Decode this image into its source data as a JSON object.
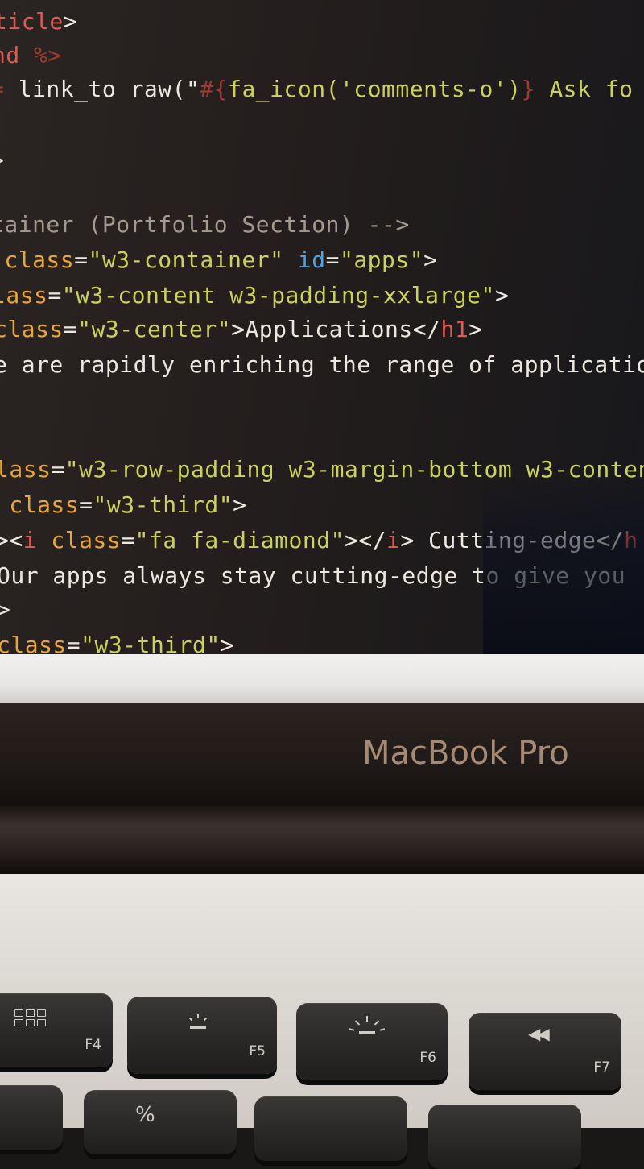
{
  "editor": {
    "lines": [
      [
        {
          "t": "ticle",
          "c": "tag"
        },
        {
          "t": ">",
          "c": "punc"
        }
      ],
      [
        {
          "t": "nd ",
          "c": "tag"
        },
        {
          "t": "%>",
          "c": "erb"
        }
      ],
      [
        {
          "t": "= ",
          "c": "erb"
        },
        {
          "t": "link_to raw(\"",
          "c": "plain"
        },
        {
          "t": "#{",
          "c": "erb"
        },
        {
          "t": "fa_icon('comments-o')",
          "c": "str"
        },
        {
          "t": "}",
          "c": "erb"
        },
        {
          "t": " Ask fo",
          "c": "str"
        }
      ],
      [],
      [
        {
          "t": ">",
          "c": "punc"
        }
      ],
      [],
      [
        {
          "t": "tainer (Portfolio Section) -->",
          "c": "comm"
        }
      ],
      [
        {
          "t": " class",
          "c": "attr"
        },
        {
          "t": "=",
          "c": "punc"
        },
        {
          "t": "\"w3-container\"",
          "c": "str"
        },
        {
          "t": " id",
          "c": "id"
        },
        {
          "t": "=",
          "c": "punc"
        },
        {
          "t": "\"apps\"",
          "c": "str"
        },
        {
          "t": ">",
          "c": "punc"
        }
      ],
      [
        {
          "t": "lass",
          "c": "attr"
        },
        {
          "t": "=",
          "c": "punc"
        },
        {
          "t": "\"w3-content w3-padding-xxlarge\"",
          "c": "str"
        },
        {
          "t": ">",
          "c": "punc"
        }
      ],
      [
        {
          "t": "class",
          "c": "attr"
        },
        {
          "t": "=",
          "c": "punc"
        },
        {
          "t": "\"w3-center\"",
          "c": "str"
        },
        {
          "t": ">Applications</",
          "c": "plain"
        },
        {
          "t": "h1",
          "c": "tag"
        },
        {
          "t": ">",
          "c": "punc"
        }
      ],
      [
        {
          "t": "e are rapidly enriching the range of applicatio",
          "c": "plain"
        }
      ],
      [],
      [],
      [
        {
          "t": "lass",
          "c": "attr"
        },
        {
          "t": "=",
          "c": "punc"
        },
        {
          "t": "\"w3-row-padding w3-margin-bottom w3-conten",
          "c": "str"
        }
      ],
      [
        {
          "t": " class",
          "c": "attr"
        },
        {
          "t": "=",
          "c": "punc"
        },
        {
          "t": "\"w3-third\"",
          "c": "str"
        },
        {
          "t": ">",
          "c": "punc"
        }
      ],
      [
        {
          "t": "><",
          "c": "punc"
        },
        {
          "t": "i",
          "c": "tag"
        },
        {
          "t": " class",
          "c": "attr"
        },
        {
          "t": "=",
          "c": "punc"
        },
        {
          "t": "\"fa fa-diamond\"",
          "c": "str"
        },
        {
          "t": "></",
          "c": "punc"
        },
        {
          "t": "i",
          "c": "tag"
        },
        {
          "t": "> Cutting-edge</",
          "c": "plain"
        },
        {
          "t": "h",
          "c": "tag"
        }
      ],
      [
        {
          "t": "Our apps always stay cutting-edge to give you",
          "c": "plain"
        }
      ],
      [
        {
          "t": ">",
          "c": "punc"
        }
      ],
      [
        {
          "t": "class",
          "c": "attr"
        },
        {
          "t": "=",
          "c": "punc"
        },
        {
          "t": "\"w3-third\"",
          "c": "str"
        },
        {
          "t": ">",
          "c": "punc"
        }
      ]
    ]
  },
  "laptop": {
    "brand_label": "MacBook Pro"
  },
  "keyboard": {
    "keys": [
      {
        "label": "F4",
        "icon": "launchpad-grid-icon"
      },
      {
        "label": "F5",
        "icon": "keyboard-brightness-down-icon"
      },
      {
        "label": "F6",
        "icon": "keyboard-brightness-up-icon"
      },
      {
        "label": "F7",
        "icon": "rewind-icon",
        "glyph": "◀◀"
      }
    ],
    "lower_key_glyph": "%"
  },
  "colors": {
    "tag": "#e05a52",
    "attr": "#e8a53a",
    "string": "#c9d25a",
    "id_attr": "#4fa3e3",
    "comment": "#a39a8d",
    "editor_bg": "#231e1d"
  }
}
